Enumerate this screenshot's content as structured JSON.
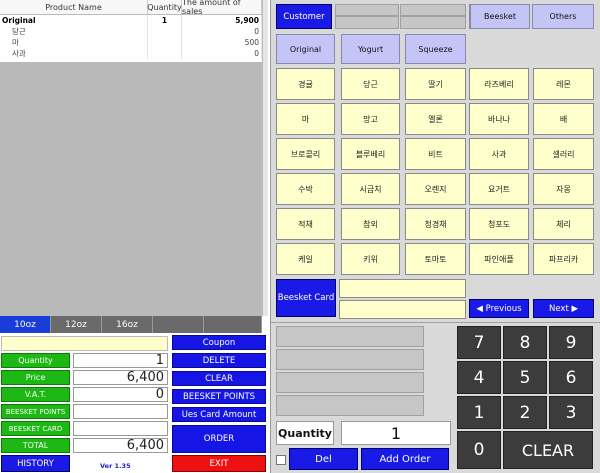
{
  "table": {
    "headers": [
      "Product Name",
      "Quantity",
      "The amount of sales"
    ],
    "rows": [
      {
        "name": "Original",
        "qty": "1",
        "amount": "5,900"
      },
      {
        "name": "당근",
        "qty": "",
        "amount": "0"
      },
      {
        "name": "마",
        "qty": "",
        "amount": "500"
      },
      {
        "name": "사과",
        "qty": "",
        "amount": "0"
      }
    ]
  },
  "size_tabs": [
    "10oz",
    "12oz",
    "16oz",
    "",
    ""
  ],
  "summary": {
    "quantity_label": "Quantity",
    "quantity_value": "1",
    "price_label": "Price",
    "price_value": "6,400",
    "vat_label": "V.A.T.",
    "vat_value": "0",
    "points_label": "BEESKET POINTS",
    "points_value": "",
    "card_label": "BEESKET CARD",
    "card_value": "",
    "total_label": "TOTAL",
    "total_value": "6,400"
  },
  "side_buttons": {
    "coupon": "Coupon",
    "delete": "DELETE",
    "clear": "CLEAR",
    "beesket_points": "BEESKET POINTS",
    "use_card_amount": "Ues Card Amount",
    "order": "ORDER"
  },
  "footer": {
    "history": "HISTORY",
    "version": "Ver 1.35",
    "exit": "EXIT"
  },
  "top_tabs": {
    "customer": "Customer",
    "beesket": "Beesket",
    "others": "Others"
  },
  "categories": [
    "Original",
    "Yogurt",
    "Squeeze"
  ],
  "products": [
    [
      "경귤",
      "당근",
      "딸기",
      "라즈베리",
      "레몬"
    ],
    [
      "마",
      "망고",
      "멜론",
      "바나나",
      "배"
    ],
    [
      "브로콜리",
      "블루베리",
      "비트",
      "사과",
      "셀러리"
    ],
    [
      "수박",
      "시금치",
      "오렌지",
      "요거트",
      "자몽"
    ],
    [
      "적채",
      "참외",
      "청경채",
      "청포도",
      "체리"
    ],
    [
      "케일",
      "키위",
      "토마토",
      "파인애플",
      "파프리카"
    ]
  ],
  "beesket_card": "Beesket Card",
  "nav": {
    "previous": "◀ Previous",
    "next": "Next ▶"
  },
  "keypad": {
    "keys": [
      "7",
      "8",
      "9",
      "4",
      "5",
      "6",
      "1",
      "2",
      "3"
    ],
    "zero": "0",
    "clear": "CLEAR"
  },
  "quantity_label": "Quantity",
  "quantity_value": "1",
  "del": "Del",
  "add_order": "Add Order",
  "colors": {
    "blue": "#1a1ae6",
    "green": "#1db814",
    "red": "#ee1111",
    "yellow": "#ffffcc",
    "lavender": "#c4c4f6",
    "keypad": "#3c3c3c"
  }
}
